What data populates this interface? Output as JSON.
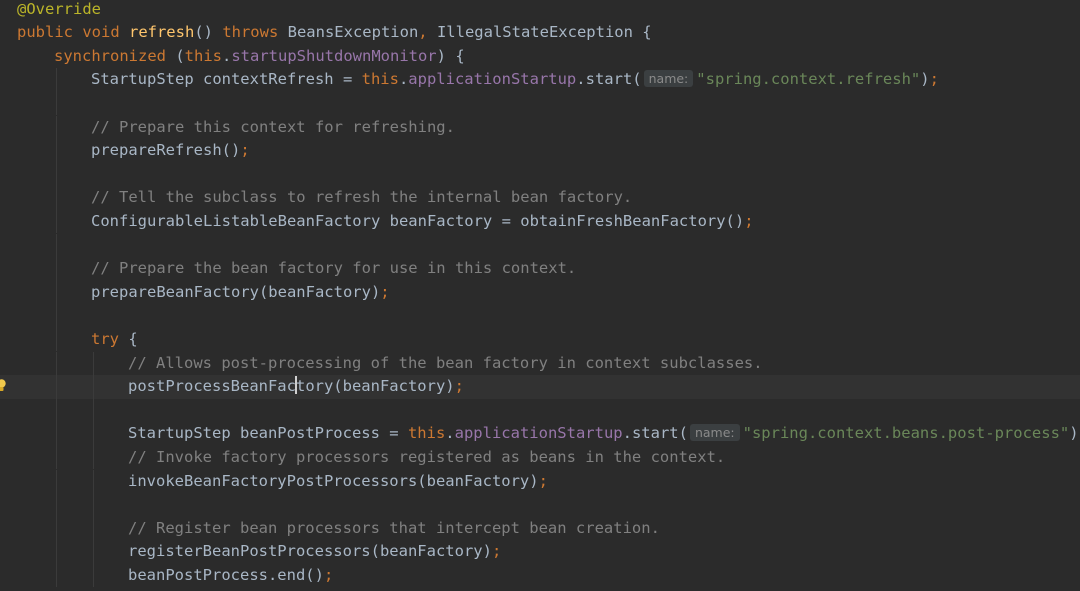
{
  "editor": {
    "inlay_hint_label": "name:",
    "lines": [
      {
        "indent": 0,
        "tokens": [
          {
            "k": "ann",
            "t": "@Override"
          }
        ]
      },
      {
        "indent": 0,
        "tokens": [
          {
            "k": "kw",
            "t": "public void "
          },
          {
            "k": "fn",
            "t": "refresh"
          },
          {
            "k": "txt",
            "t": "() "
          },
          {
            "k": "kw",
            "t": "throws "
          },
          {
            "k": "txt",
            "t": "BeansException"
          },
          {
            "k": "kw",
            "t": ", "
          },
          {
            "k": "txt",
            "t": "IllegalStateException {"
          }
        ]
      },
      {
        "indent": 1,
        "tokens": [
          {
            "k": "kw",
            "t": "synchronized "
          },
          {
            "k": "txt",
            "t": "("
          },
          {
            "k": "kw",
            "t": "this"
          },
          {
            "k": "txt",
            "t": "."
          },
          {
            "k": "field",
            "t": "startupShutdownMonitor"
          },
          {
            "k": "txt",
            "t": ") {"
          }
        ]
      },
      {
        "indent": 2,
        "tokens": [
          {
            "k": "txt",
            "t": "StartupStep contextRefresh = "
          },
          {
            "k": "kw",
            "t": "this"
          },
          {
            "k": "txt",
            "t": "."
          },
          {
            "k": "field",
            "t": "applicationStartup"
          },
          {
            "k": "txt",
            "t": ".start("
          },
          {
            "k": "hint",
            "t": "name:"
          },
          {
            "k": "str",
            "t": "\"spring.context.refresh\""
          },
          {
            "k": "txt",
            "t": ")"
          },
          {
            "k": "kw",
            "t": ";"
          }
        ]
      },
      {
        "indent": 2,
        "tokens": []
      },
      {
        "indent": 2,
        "tokens": [
          {
            "k": "cmt",
            "t": "// Prepare this context for refreshing."
          }
        ]
      },
      {
        "indent": 2,
        "tokens": [
          {
            "k": "txt",
            "t": "prepareRefresh()"
          },
          {
            "k": "kw",
            "t": ";"
          }
        ]
      },
      {
        "indent": 2,
        "tokens": []
      },
      {
        "indent": 2,
        "tokens": [
          {
            "k": "cmt",
            "t": "// Tell the subclass to refresh the internal bean factory."
          }
        ]
      },
      {
        "indent": 2,
        "tokens": [
          {
            "k": "txt",
            "t": "ConfigurableListableBeanFactory beanFactory = obtainFreshBeanFactory()"
          },
          {
            "k": "kw",
            "t": ";"
          }
        ]
      },
      {
        "indent": 2,
        "tokens": []
      },
      {
        "indent": 2,
        "tokens": [
          {
            "k": "cmt",
            "t": "// Prepare the bean factory for use in this context."
          }
        ]
      },
      {
        "indent": 2,
        "tokens": [
          {
            "k": "txt",
            "t": "prepareBeanFactory(beanFactory)"
          },
          {
            "k": "kw",
            "t": ";"
          }
        ]
      },
      {
        "indent": 2,
        "tokens": []
      },
      {
        "indent": 2,
        "tokens": [
          {
            "k": "kw",
            "t": "try "
          },
          {
            "k": "txt",
            "t": "{"
          }
        ]
      },
      {
        "indent": 3,
        "tokens": [
          {
            "k": "cmt",
            "t": "// Allows post-processing of the bean factory in context subclasses."
          }
        ]
      },
      {
        "indent": 3,
        "current": true,
        "bulb": true,
        "tokens": [
          {
            "k": "txt",
            "t": "postProcessBeanFac"
          },
          {
            "k": "caret",
            "t": ""
          },
          {
            "k": "txt",
            "t": "tory(beanFactory)"
          },
          {
            "k": "kw",
            "t": ";"
          }
        ]
      },
      {
        "indent": 3,
        "tokens": []
      },
      {
        "indent": 3,
        "tokens": [
          {
            "k": "txt",
            "t": "StartupStep beanPostProcess = "
          },
          {
            "k": "kw",
            "t": "this"
          },
          {
            "k": "txt",
            "t": "."
          },
          {
            "k": "field",
            "t": "applicationStartup"
          },
          {
            "k": "txt",
            "t": ".start("
          },
          {
            "k": "hint",
            "t": "name:"
          },
          {
            "k": "str",
            "t": "\"spring.context.beans.post-process\""
          },
          {
            "k": "txt",
            "t": ")"
          },
          {
            "k": "kw",
            "t": ";"
          }
        ]
      },
      {
        "indent": 3,
        "tokens": [
          {
            "k": "cmt",
            "t": "// Invoke factory processors registered as beans in the context."
          }
        ]
      },
      {
        "indent": 3,
        "tokens": [
          {
            "k": "txt",
            "t": "invokeBeanFactoryPostProcessors(beanFactory)"
          },
          {
            "k": "kw",
            "t": ";"
          }
        ]
      },
      {
        "indent": 3,
        "tokens": []
      },
      {
        "indent": 3,
        "tokens": [
          {
            "k": "cmt",
            "t": "// Register bean processors that intercept bean creation."
          }
        ]
      },
      {
        "indent": 3,
        "tokens": [
          {
            "k": "txt",
            "t": "registerBeanPostProcessors(beanFactory)"
          },
          {
            "k": "kw",
            "t": ";"
          }
        ]
      },
      {
        "indent": 3,
        "tokens": [
          {
            "k": "txt",
            "t": "beanPostProcess.end()"
          },
          {
            "k": "kw",
            "t": ";"
          }
        ]
      }
    ]
  }
}
